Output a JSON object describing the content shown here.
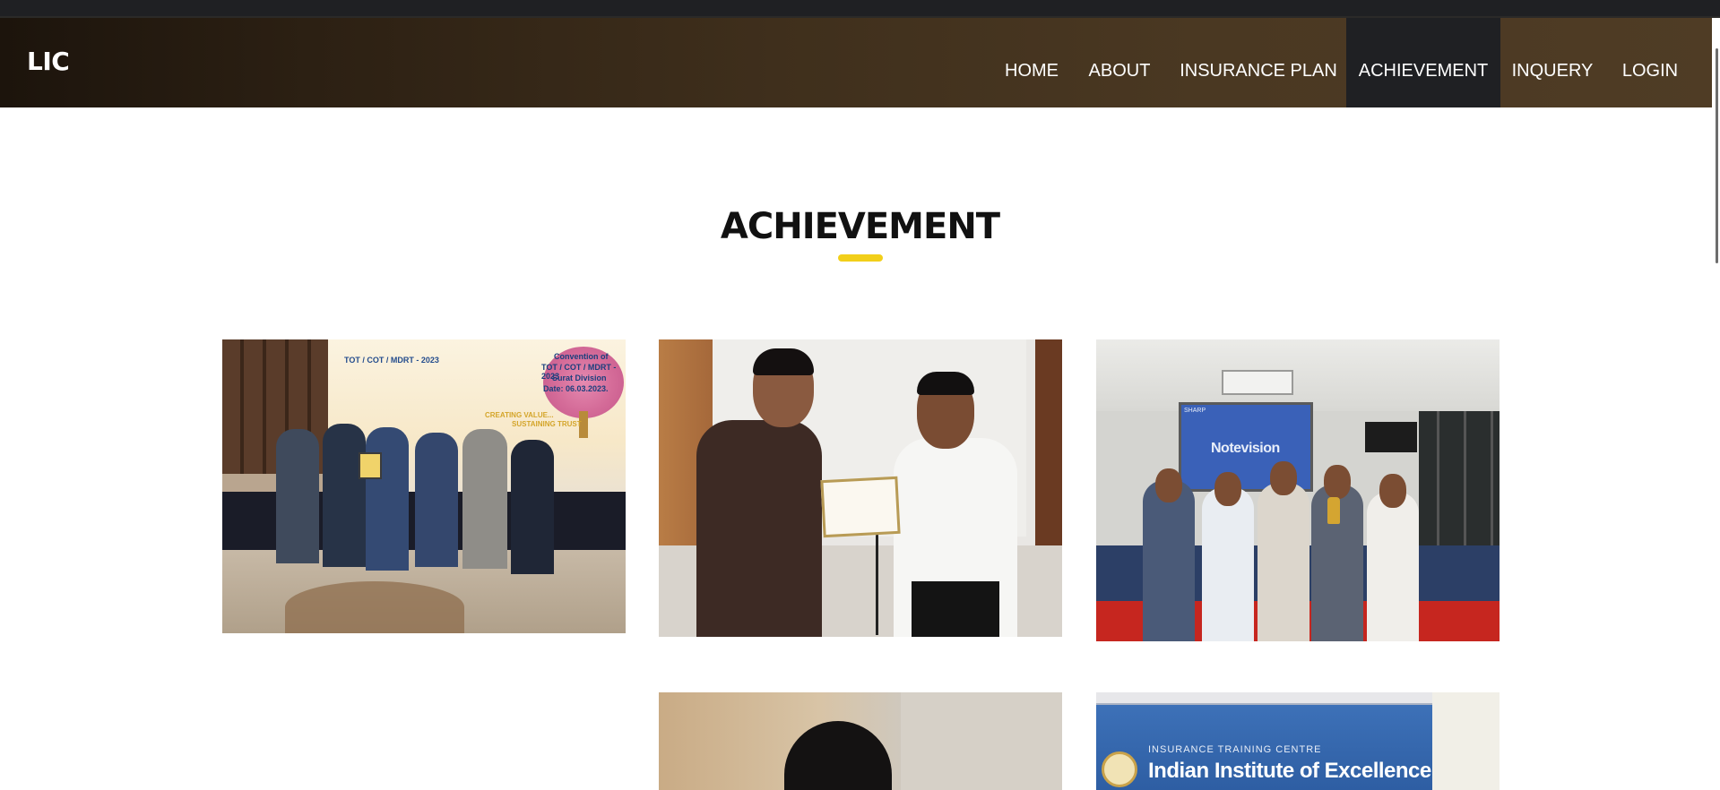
{
  "brand": {
    "logo_text": "LIC"
  },
  "nav": {
    "items": [
      {
        "label": "HOME",
        "active": false
      },
      {
        "label": "ABOUT",
        "active": false
      },
      {
        "label": "INSURANCE PLAN",
        "active": false
      },
      {
        "label": "ACHIEVEMENT",
        "active": true
      },
      {
        "label": "INQUERY",
        "active": false
      },
      {
        "label": "LOGIN",
        "active": false
      }
    ]
  },
  "section": {
    "title": "ACHIEVEMENT",
    "accent_color": "#f2cf1a"
  },
  "gallery": {
    "photos": [
      {
        "kind": "group award photo",
        "banner_lines": [
          "TOT / COT / MDRT - 2023",
          "Convention of",
          "TOT / COT / MDRT - 2023",
          "Surat Division",
          "Date: 06.03.2023.",
          "CREATING VALUE...",
          "SUSTAINING TRUST"
        ]
      },
      {
        "kind": "certificate presentation photo"
      },
      {
        "kind": "trophy group photo",
        "screen_text": "Notevision",
        "screen_brand": "SHARP"
      },
      {
        "kind": "portrait photo"
      },
      {
        "kind": "banner photo",
        "banner_small": "INSURANCE TRAINING CENTRE",
        "banner_big": "Indian Institute of Excellence"
      }
    ]
  },
  "colors": {
    "nav_active_bg": "#1f2023",
    "nav_gradient_start": "#1c140c",
    "nav_gradient_end": "#4f3c25"
  }
}
